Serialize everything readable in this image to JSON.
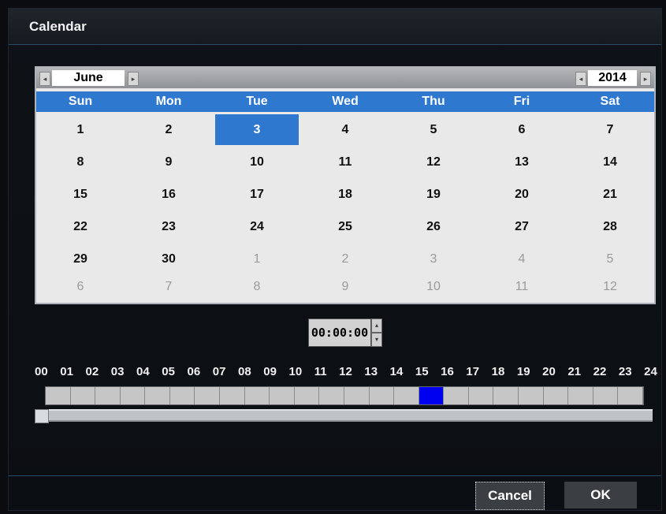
{
  "window": {
    "title": "Calendar"
  },
  "calendar": {
    "month": "June",
    "year": "2014",
    "weekdays": [
      "Sun",
      "Mon",
      "Tue",
      "Wed",
      "Thu",
      "Fri",
      "Sat"
    ],
    "selected_day": "3",
    "weeks": [
      [
        {
          "d": "1",
          "dim": false
        },
        {
          "d": "2",
          "dim": false
        },
        {
          "d": "3",
          "dim": false,
          "sel": true
        },
        {
          "d": "4",
          "dim": false
        },
        {
          "d": "5",
          "dim": false
        },
        {
          "d": "6",
          "dim": false
        },
        {
          "d": "7",
          "dim": false
        }
      ],
      [
        {
          "d": "8",
          "dim": false
        },
        {
          "d": "9",
          "dim": false
        },
        {
          "d": "10",
          "dim": false
        },
        {
          "d": "11",
          "dim": false
        },
        {
          "d": "12",
          "dim": false
        },
        {
          "d": "13",
          "dim": false
        },
        {
          "d": "14",
          "dim": false
        }
      ],
      [
        {
          "d": "15",
          "dim": false
        },
        {
          "d": "16",
          "dim": false
        },
        {
          "d": "17",
          "dim": false
        },
        {
          "d": "18",
          "dim": false
        },
        {
          "d": "19",
          "dim": false
        },
        {
          "d": "20",
          "dim": false
        },
        {
          "d": "21",
          "dim": false
        }
      ],
      [
        {
          "d": "22",
          "dim": false
        },
        {
          "d": "23",
          "dim": false
        },
        {
          "d": "24",
          "dim": false
        },
        {
          "d": "25",
          "dim": false
        },
        {
          "d": "26",
          "dim": false
        },
        {
          "d": "27",
          "dim": false
        },
        {
          "d": "28",
          "dim": false
        }
      ],
      [
        {
          "d": "29",
          "dim": false
        },
        {
          "d": "30",
          "dim": false
        },
        {
          "d": "1",
          "dim": true
        },
        {
          "d": "2",
          "dim": true
        },
        {
          "d": "3",
          "dim": true
        },
        {
          "d": "4",
          "dim": true
        },
        {
          "d": "5",
          "dim": true
        }
      ],
      [
        {
          "d": "6",
          "dim": true
        },
        {
          "d": "7",
          "dim": true
        },
        {
          "d": "8",
          "dim": true
        },
        {
          "d": "9",
          "dim": true
        },
        {
          "d": "10",
          "dim": true
        },
        {
          "d": "11",
          "dim": true
        },
        {
          "d": "12",
          "dim": true
        }
      ]
    ]
  },
  "time": {
    "value": "00:00:00"
  },
  "timeline": {
    "hours": [
      "00",
      "01",
      "02",
      "03",
      "04",
      "05",
      "06",
      "07",
      "08",
      "09",
      "10",
      "11",
      "12",
      "13",
      "14",
      "15",
      "16",
      "17",
      "18",
      "19",
      "20",
      "21",
      "22",
      "23",
      "24"
    ],
    "slots": 24,
    "recorded_hour_index": 15,
    "colors": {
      "slot": "#c6c6c6",
      "recorded": "#0000f0"
    }
  },
  "buttons": {
    "cancel": "Cancel",
    "ok": "OK"
  },
  "colors": {
    "accent": "#2e78d0"
  }
}
